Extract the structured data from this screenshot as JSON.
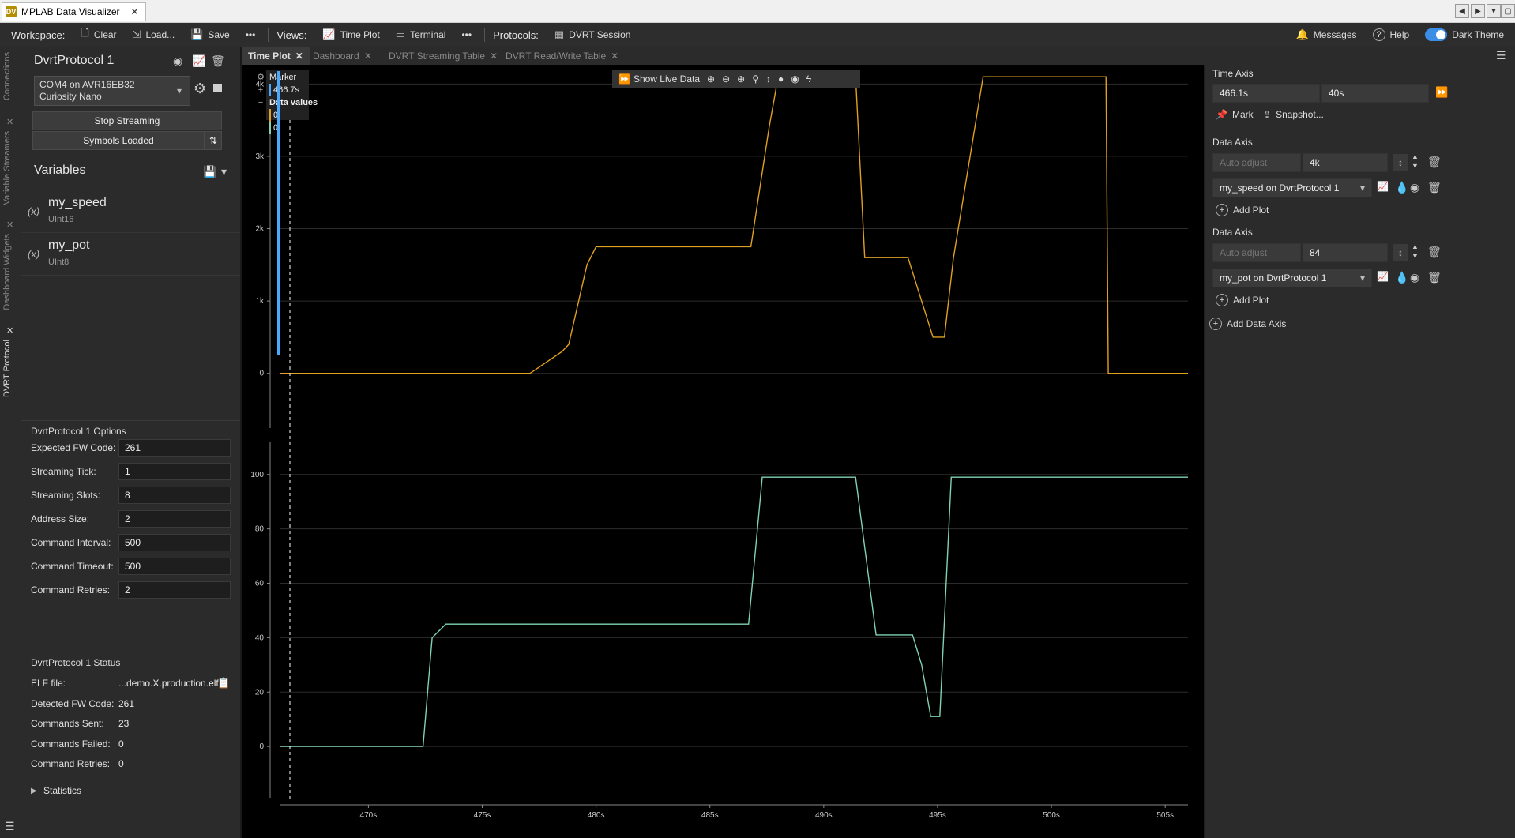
{
  "window": {
    "tab_title": "MPLAB Data Visualizer",
    "app_icon_text": "DV"
  },
  "toolbar": {
    "workspace_label": "Workspace:",
    "clear": "Clear",
    "load": "Load...",
    "save": "Save",
    "more": "•••",
    "views_label": "Views:",
    "time_plot": "Time Plot",
    "terminal": "Terminal",
    "protocols_label": "Protocols:",
    "dvrt_session": "DVRT Session",
    "messages": "Messages",
    "help": "Help",
    "dark_theme": "Dark Theme"
  },
  "rail": {
    "tabs": [
      "Connections",
      "Variable Streamers",
      "Dashboard Widgets",
      "DVRT Protocol"
    ]
  },
  "left": {
    "title": "DvrtProtocol 1",
    "connection": "COM4 on AVR16EB32 Curiosity Nano",
    "stop_streaming": "Stop Streaming",
    "symbols_loaded": "Symbols Loaded",
    "variables_title": "Variables",
    "variables": [
      {
        "name": "my_speed",
        "type": "UInt16"
      },
      {
        "name": "my_pot",
        "type": "UInt8"
      }
    ],
    "options_title": "DvrtProtocol 1 Options",
    "options": [
      {
        "label": "Expected FW Code:",
        "value": "261"
      },
      {
        "label": "Streaming Tick:",
        "value": "1"
      },
      {
        "label": "Streaming Slots:",
        "value": "8"
      },
      {
        "label": "Address Size:",
        "value": "2"
      },
      {
        "label": "Command Interval:",
        "value": "500"
      },
      {
        "label": "Command Timeout:",
        "value": "500"
      },
      {
        "label": "Command Retries:",
        "value": "2"
      }
    ],
    "status_title": "DvrtProtocol 1 Status",
    "status": [
      {
        "label": "ELF file:",
        "value": "...demo.X.production.elf"
      },
      {
        "label": "Detected FW Code:",
        "value": "261"
      },
      {
        "label": "Commands Sent:",
        "value": "23"
      },
      {
        "label": "Commands Failed:",
        "value": "0"
      },
      {
        "label": "Command Retries:",
        "value": "0"
      }
    ],
    "statistics": "Statistics"
  },
  "doc_tabs": [
    "Time Plot",
    "Dashboard",
    "DVRT Streaming Table",
    "DVRT Read/Write Table"
  ],
  "plot": {
    "show_live_data": "Show Live Data",
    "marker": {
      "title": "Marker",
      "time": "466.7s",
      "data_values_title": "Data values",
      "values": [
        "0",
        "0"
      ]
    },
    "colors": {
      "speed": "#e0a020",
      "pot": "#7fd3b0"
    }
  },
  "right": {
    "time_axis_title": "Time Axis",
    "time_start": "466.1s",
    "time_span": "40s",
    "mark": "Mark",
    "snapshot": "Snapshot...",
    "data_axes": [
      {
        "title": "Data Axis",
        "auto_adjust": "Auto adjust",
        "range": "4k",
        "plot": "my_speed on DvrtProtocol 1",
        "color": "#e0a020",
        "add_plot": "Add Plot"
      },
      {
        "title": "Data Axis",
        "auto_adjust": "Auto adjust",
        "range": "84",
        "plot": "my_pot on DvrtProtocol 1",
        "color": "#7fd3b0",
        "add_plot": "Add Plot"
      }
    ],
    "add_data_axis": "Add Data Axis"
  },
  "chart_data": [
    {
      "type": "line",
      "series": [
        {
          "name": "my_speed on DvrtProtocol 1",
          "x": [
            466.1,
            477.1,
            478.5,
            478.8,
            479.6,
            480.0,
            486.8,
            487.6,
            488.0,
            491.4,
            491.8,
            493.7,
            494.0,
            494.8,
            495.3,
            495.7,
            497.0,
            502.4,
            502.5,
            506.0
          ],
          "y": [
            0,
            0,
            300,
            400,
            1500,
            1750,
            1750,
            3400,
            4100,
            4100,
            1600,
            1600,
            1300,
            500,
            500,
            1600,
            4100,
            4100,
            0,
            0
          ]
        }
      ],
      "y_ticks": [
        "0",
        "1k",
        "2k",
        "3k",
        "4k"
      ],
      "ylim": [
        -800,
        4200
      ]
    },
    {
      "type": "line",
      "series": [
        {
          "name": "my_pot on DvrtProtocol 1",
          "x": [
            466.1,
            472.4,
            472.8,
            473.4,
            486.7,
            487.3,
            491.4,
            492.3,
            493.9,
            494.3,
            494.7,
            495.1,
            495.6,
            506.0
          ],
          "y": [
            0,
            0,
            40,
            45,
            45,
            99,
            99,
            41,
            41,
            30,
            11,
            11,
            99,
            99
          ]
        }
      ],
      "y_ticks": [
        "0",
        "20",
        "40",
        "60",
        "80",
        "100"
      ],
      "ylim": [
        -20,
        113
      ]
    }
  ],
  "x_axis": {
    "ticks": [
      "470s",
      "475s",
      "480s",
      "485s",
      "490s",
      "495s",
      "500s",
      "505s"
    ],
    "xlim": [
      466.1,
      506.0
    ]
  }
}
